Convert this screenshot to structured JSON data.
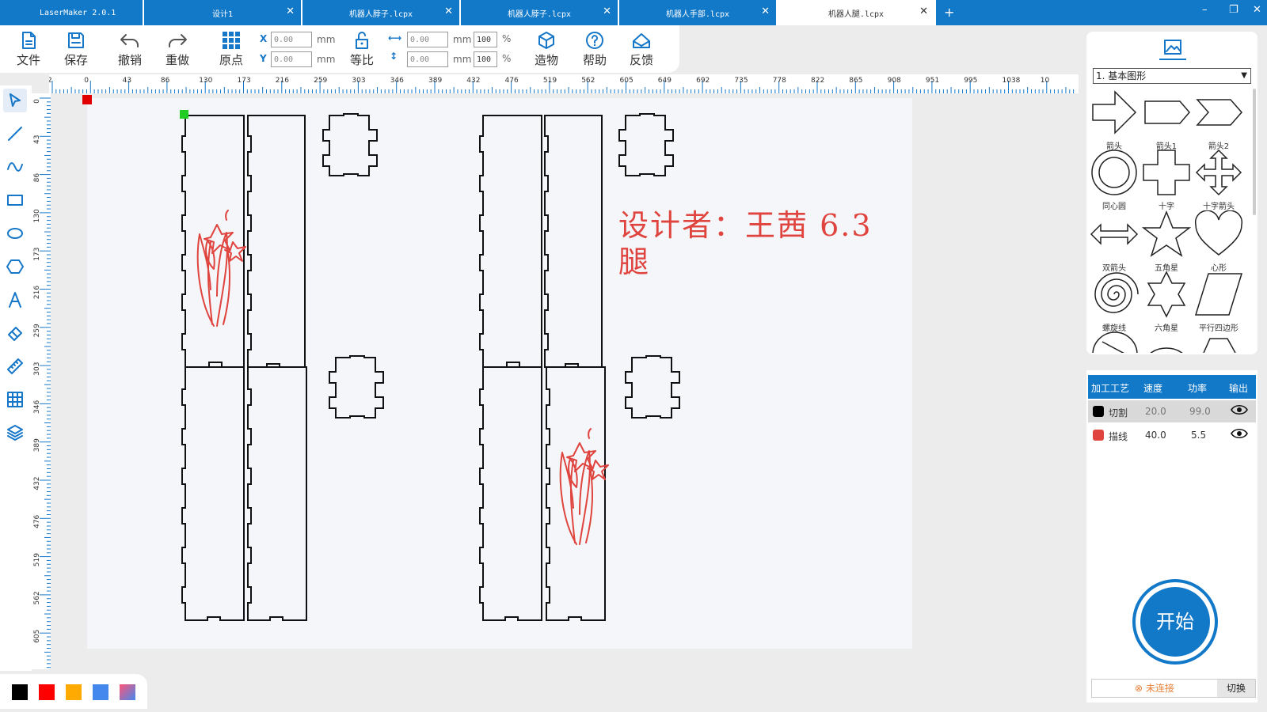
{
  "tabs": [
    {
      "label": "LaserMaker 2.0.1"
    },
    {
      "label": "设计1"
    },
    {
      "label": "机器人脖子.lcpx"
    },
    {
      "label": "机器人脖子.lcpx"
    },
    {
      "label": "机器人手部.lcpx"
    },
    {
      "label": "机器人腿.lcpx"
    }
  ],
  "tab_add": "+",
  "window_controls": {
    "minimize": "–",
    "restore": "❐",
    "close": "✕"
  },
  "toolbar": {
    "file": "文件",
    "save": "保存",
    "undo": "撤销",
    "redo": "重做",
    "origin": "原点",
    "x_label": "X",
    "y_label": "Y",
    "x_value": "0.00",
    "y_value": "0.00",
    "unit": "mm",
    "ratio": "等比",
    "width_value": "0.00",
    "height_value": "0.00",
    "width_pct": "100",
    "height_pct": "100",
    "pct": "%",
    "build": "造物",
    "help": "帮助",
    "feedback": "反馈"
  },
  "ruler_top_labels": [
    "2",
    "0",
    "43",
    "86",
    "130",
    "173",
    "216",
    "259",
    "303",
    "346",
    "389",
    "432",
    "476",
    "519",
    "562",
    "605",
    "649",
    "692",
    "735",
    "778",
    "822",
    "865",
    "908",
    "951",
    "995",
    "1038",
    "10"
  ],
  "ruler_left_labels": [
    "0",
    "43",
    "86",
    "130",
    "173",
    "216",
    "259",
    "303",
    "346",
    "389",
    "432",
    "476",
    "519",
    "562",
    "605"
  ],
  "canvas_text": {
    "line1": "设计者：王茜 6.3",
    "line2": "腿"
  },
  "palette_colors": [
    "#000000",
    "#ff0000",
    "#ffaa00",
    "#4488ee",
    "#ee5599"
  ],
  "shapes_panel": {
    "category": "1. 基本图形",
    "shapes": [
      {
        "label": "箭头",
        "icon": "arrow-icon"
      },
      {
        "label": "箭头1",
        "icon": "arrow1-icon"
      },
      {
        "label": "箭头2",
        "icon": "arrow2-icon"
      },
      {
        "label": "同心圆",
        "icon": "concentric-circle-icon"
      },
      {
        "label": "十字",
        "icon": "cross-icon"
      },
      {
        "label": "十字箭头",
        "icon": "cross-arrow-icon"
      },
      {
        "label": "双箭头",
        "icon": "double-arrow-icon"
      },
      {
        "label": "五角星",
        "icon": "five-star-icon"
      },
      {
        "label": "心形",
        "icon": "heart-icon"
      },
      {
        "label": "螺旋线",
        "icon": "spiral-icon"
      },
      {
        "label": "六角星",
        "icon": "six-star-icon"
      },
      {
        "label": "平行四边形",
        "icon": "parallelogram-icon"
      }
    ]
  },
  "process": {
    "headers": {
      "process": "加工工艺",
      "speed": "速度",
      "power": "功率",
      "output": "输出"
    },
    "rows": [
      {
        "color": "#000000",
        "name": "切割",
        "speed": "20.0",
        "power": "99.0"
      },
      {
        "color": "#e0443e",
        "name": "描线",
        "speed": "40.0",
        "power": "5.5"
      }
    ]
  },
  "start_label": "开始",
  "connection_status": "未连接",
  "switch_label": "切换"
}
